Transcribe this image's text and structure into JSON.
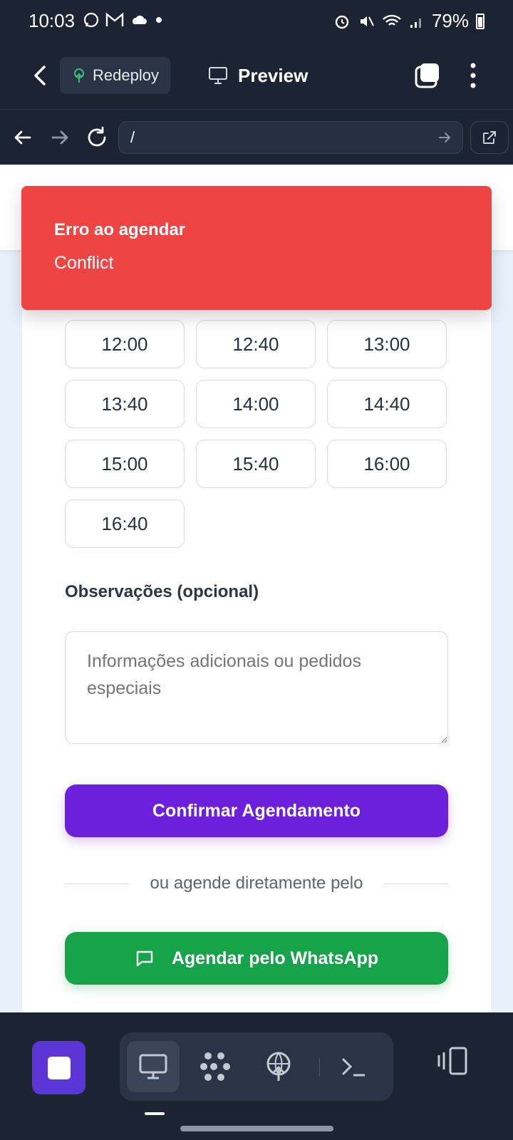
{
  "status_bar": {
    "time": "10:03",
    "battery": "79%"
  },
  "app_bar": {
    "redeploy_label": "Redeploy",
    "preview_label": "Preview"
  },
  "url_bar": {
    "url": "/"
  },
  "toast": {
    "title": "Erro ao agendar",
    "description": "Conflict",
    "color": "#ef4444"
  },
  "time_slots": [
    "12:00",
    "12:40",
    "13:00",
    "13:40",
    "14:00",
    "14:40",
    "15:00",
    "15:40",
    "16:00",
    "16:40"
  ],
  "form": {
    "observations_label": "Observações (opcional)",
    "observations_placeholder": "Informações adicionais ou pedidos especiais",
    "confirm_label": "Confirmar Agendamento",
    "divider_text": "ou agende diretamente pelo",
    "whatsapp_label": "Agendar pelo WhatsApp"
  },
  "colors": {
    "accent": "#6d20dc",
    "whatsapp": "#16a34a",
    "chrome": "#1c2434"
  }
}
